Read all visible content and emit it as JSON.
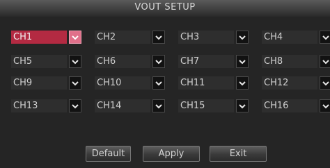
{
  "title": "VOUT SETUP",
  "channels": [
    {
      "label": "CH1",
      "selected": true
    },
    {
      "label": "CH2"
    },
    {
      "label": "CH3"
    },
    {
      "label": "CH4"
    },
    {
      "label": "CH5"
    },
    {
      "label": "CH6"
    },
    {
      "label": "CH7"
    },
    {
      "label": "CH8"
    },
    {
      "label": "CH9"
    },
    {
      "label": "CH10"
    },
    {
      "label": "CH11"
    },
    {
      "label": "CH12"
    },
    {
      "label": "CH13"
    },
    {
      "label": "CH14"
    },
    {
      "label": "CH15"
    },
    {
      "label": "CH16"
    }
  ],
  "buttons": {
    "default": "Default",
    "apply": "Apply",
    "exit": "Exit"
  },
  "colors": {
    "selected": "#b32a42"
  }
}
